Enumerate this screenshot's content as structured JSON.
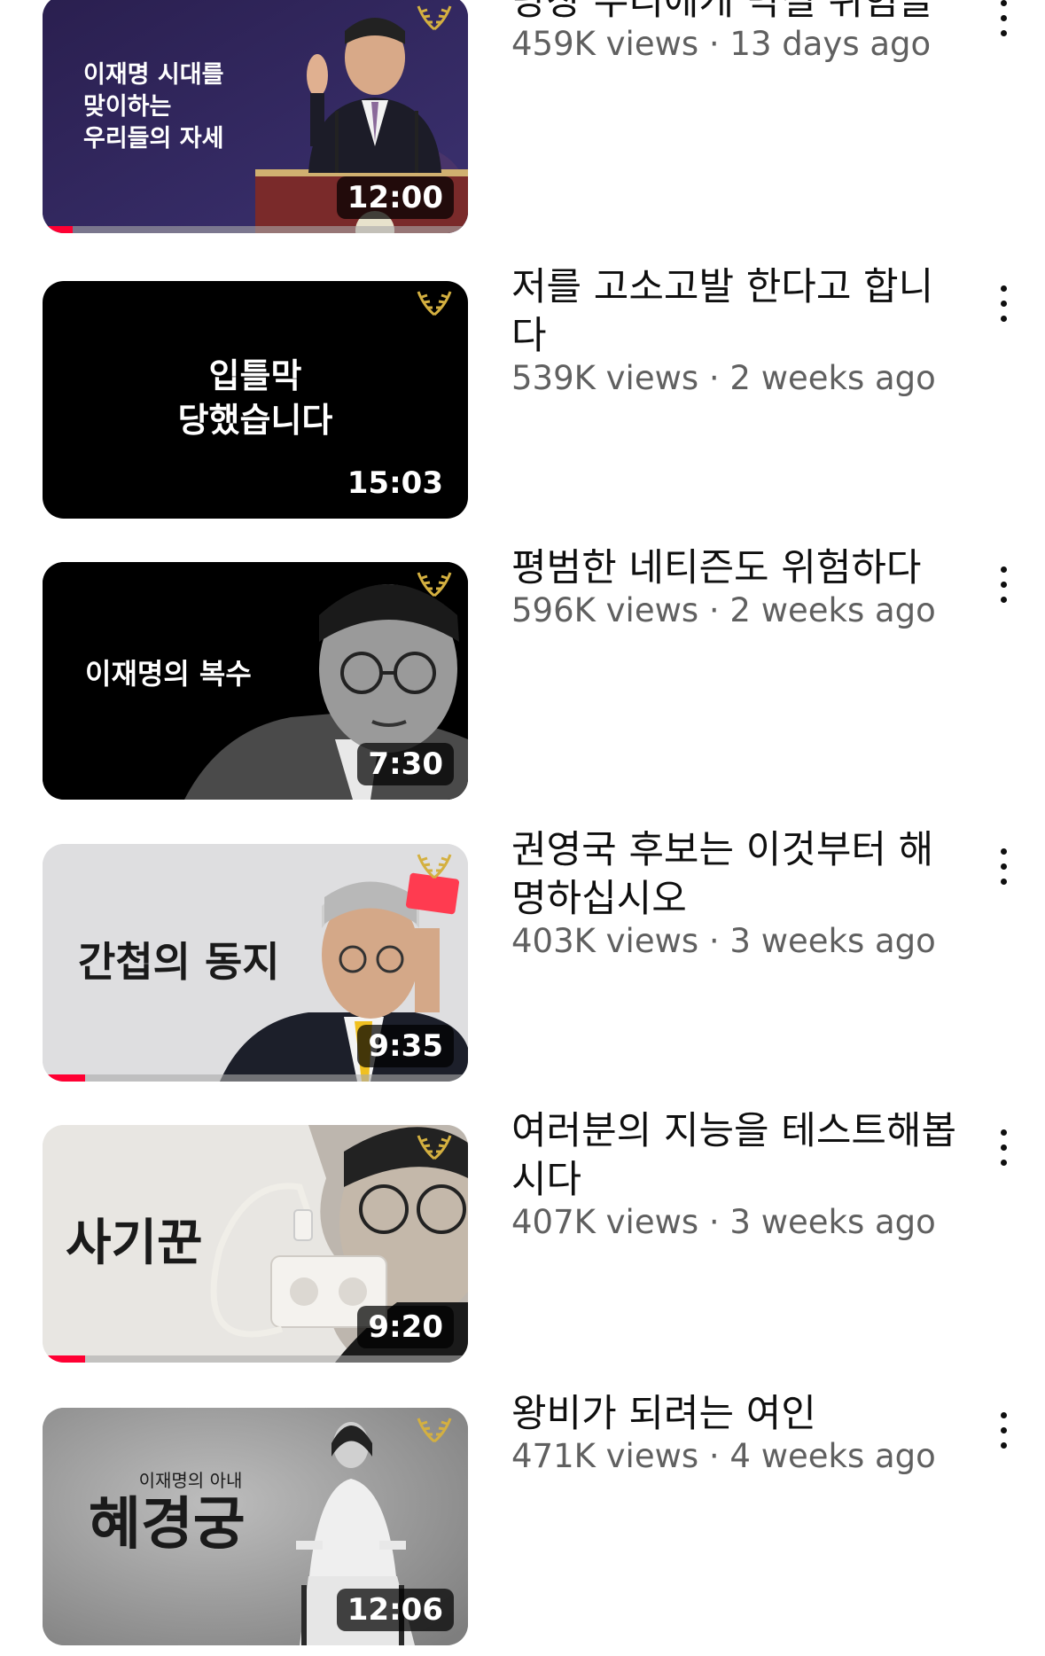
{
  "videos": [
    {
      "title": "당장 우리에게 닥칠 위험들",
      "views": "459K views",
      "age": "13 days ago",
      "duration": "12:00",
      "thumbnail_text": [
        "이재명 시대를",
        "맞이하는",
        "우리들의 자세"
      ],
      "progress": 0.07,
      "icon": "laurel-icon"
    },
    {
      "title": "저를 고소고발 한다고 합니다",
      "views": "539K views",
      "age": "2 weeks ago",
      "duration": "15:03",
      "thumbnail_text": [
        "입틀막",
        "당했습니다"
      ],
      "progress": 0,
      "icon": "laurel-icon"
    },
    {
      "title": "평범한 네티즌도 위험하다",
      "views": "596K views",
      "age": "2 weeks ago",
      "duration": "7:30",
      "thumbnail_text": [
        "이재명의 복수"
      ],
      "progress": 0,
      "icon": "laurel-icon"
    },
    {
      "title": "권영국 후보는 이것부터 해명하십시오",
      "views": "403K views",
      "age": "3 weeks ago",
      "duration": "9:35",
      "thumbnail_text": [
        "간첩의 동지"
      ],
      "progress": 0.1,
      "icon": "laurel-icon"
    },
    {
      "title": "여러분의 지능을 테스트해봅시다",
      "views": "407K views",
      "age": "3 weeks ago",
      "duration": "9:20",
      "thumbnail_text": [
        "사기꾼"
      ],
      "progress": 0.1,
      "icon": "laurel-icon"
    },
    {
      "title": "왕비가 되려는 여인",
      "views": "471K views",
      "age": "4 weeks ago",
      "duration": "12:06",
      "thumbnail_text": [
        "이재명의 아내",
        "혜경궁"
      ],
      "progress": 0,
      "icon": "laurel-icon"
    }
  ],
  "separator": " · ",
  "menu_icon": "more-vertical-icon",
  "colors": {
    "title": "#0f0f0f",
    "meta": "#606060",
    "progress": "#ff0033",
    "background": "#ffffff"
  }
}
